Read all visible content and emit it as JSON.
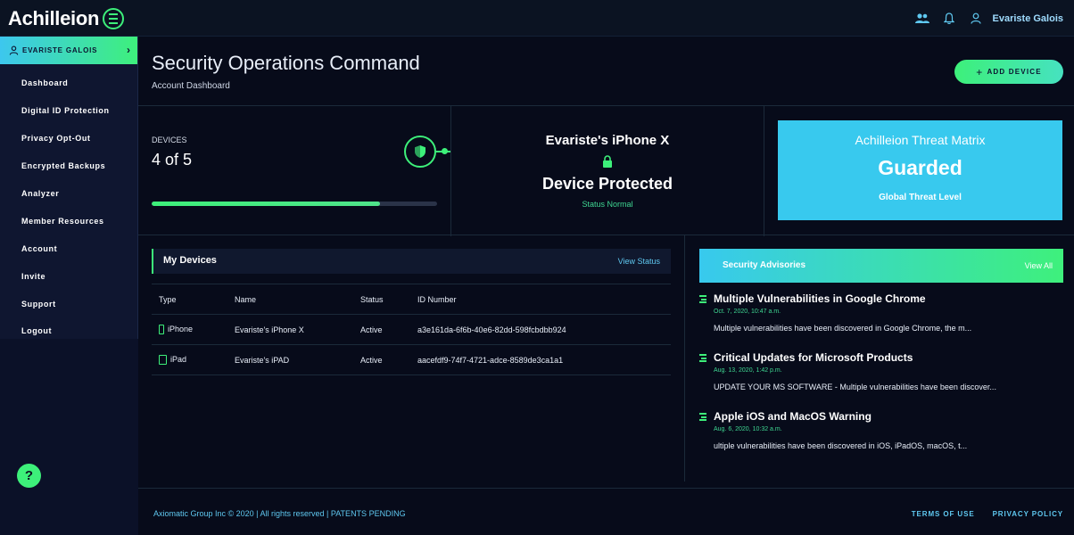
{
  "app": {
    "brand": "Achilleion"
  },
  "topbar": {
    "user_name": "Evariste Galois"
  },
  "sidebar": {
    "user_label": "EVARISTE GALOIS",
    "items": [
      {
        "label": "Dashboard"
      },
      {
        "label": "Digital ID Protection"
      },
      {
        "label": "Privacy Opt-Out"
      },
      {
        "label": "Encrypted Backups"
      },
      {
        "label": "Analyzer"
      },
      {
        "label": "Member Resources"
      },
      {
        "label": "Account"
      },
      {
        "label": "Invite"
      },
      {
        "label": "Support"
      },
      {
        "label": "Logout"
      }
    ],
    "help_label": "?"
  },
  "header": {
    "title": "Security Operations Command",
    "subtitle": "Account Dashboard",
    "add_device_label": "ADD DEVICE"
  },
  "devices_summary": {
    "label": "DEVICES",
    "count_text": "4 of 5",
    "progress": 0.8
  },
  "device_status": {
    "name": "Evariste's iPhone X",
    "status": "Device Protected",
    "note": "Status Normal"
  },
  "threat_matrix": {
    "title": "Achilleion Threat Matrix",
    "level": "Guarded",
    "subtitle": "Global Threat Level"
  },
  "my_devices": {
    "title": "My Devices",
    "link": "View Status",
    "columns": [
      "Type",
      "Name",
      "Status",
      "ID Number"
    ],
    "rows": [
      {
        "type": "iPhone",
        "name": "Evariste's iPhone X",
        "status": "Active",
        "id": "a3e161da-6f6b-40e6-82dd-598fcbdbb924"
      },
      {
        "type": "iPad",
        "name": "Evariste's iPAD",
        "status": "Active",
        "id": "aacefdf9-74f7-4721-adce-8589de3ca1a1"
      }
    ]
  },
  "advisories": {
    "title": "Security Advisories",
    "link": "View All",
    "items": [
      {
        "title": "Multiple Vulnerabilities in Google Chrome",
        "date": "Oct. 7, 2020, 10:47 a.m.",
        "text": "Multiple vulnerabilities have been discovered in Google Chrome, the m..."
      },
      {
        "title": "Critical Updates for Microsoft Products",
        "date": "Aug. 13, 2020, 1:42 p.m.",
        "text": "UPDATE YOUR MS SOFTWARE - Multiple vulnerabilities have been discover..."
      },
      {
        "title": "Apple iOS and MacOS Warning",
        "date": "Aug. 6, 2020, 10:32 a.m.",
        "text": "ultiple vulnerabilities have been discovered in iOS, iPadOS, macOS, t..."
      }
    ]
  },
  "footer": {
    "copyright": "Axiomatic Group Inc © 2020 | All rights reserved | PATENTS PENDING",
    "terms": "TERMS OF USE",
    "privacy": "PRIVACY POLICY"
  },
  "colors": {
    "accent_green": "#3df07a",
    "accent_cyan": "#38c9ee",
    "background": "#070b1a",
    "sidebar": "#0f1630"
  },
  "icons": [
    "menu-icon",
    "users-icon",
    "bell-icon",
    "user-icon",
    "chevron-right-icon",
    "shield-icon",
    "lock-icon",
    "phone-icon",
    "tablet-icon",
    "list-icon",
    "plus-icon"
  ]
}
